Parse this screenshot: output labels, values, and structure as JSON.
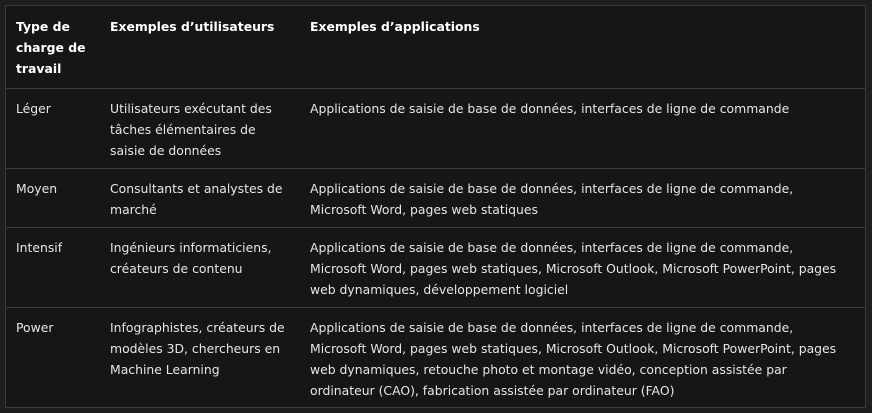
{
  "table": {
    "headers": [
      "Type de charge de travail",
      "Exemples d’utilisateurs",
      "Exemples d’applications"
    ],
    "rows": [
      {
        "type": "Léger",
        "users": "Utilisateurs exécutant des tâches élémentaires de saisie de données",
        "apps": "Applications de saisie de base de données, interfaces de ligne de commande"
      },
      {
        "type": "Moyen",
        "users": "Consultants et analystes de marché",
        "apps": "Applications de saisie de base de données, interfaces de ligne de commande, Microsoft Word, pages web statiques"
      },
      {
        "type": "Intensif",
        "users": "Ingénieurs informaticiens, créateurs de contenu",
        "apps": "Applications de saisie de base de données, interfaces de ligne de commande, Microsoft Word, pages web statiques, Microsoft Outlook, Microsoft PowerPoint, pages web dynamiques, développement logiciel"
      },
      {
        "type": "Power",
        "users": "Infographistes, créateurs de modèles 3D, chercheurs en Machine Learning",
        "apps": "Applications de saisie de base de données, interfaces de ligne de commande, Microsoft Word, pages web statiques, Microsoft Outlook, Microsoft PowerPoint, pages web dynamiques, retouche photo et montage vidéo, conception assistée par ordinateur (CAO), fabrication assistée par ordinateur (FAO)"
      }
    ]
  }
}
